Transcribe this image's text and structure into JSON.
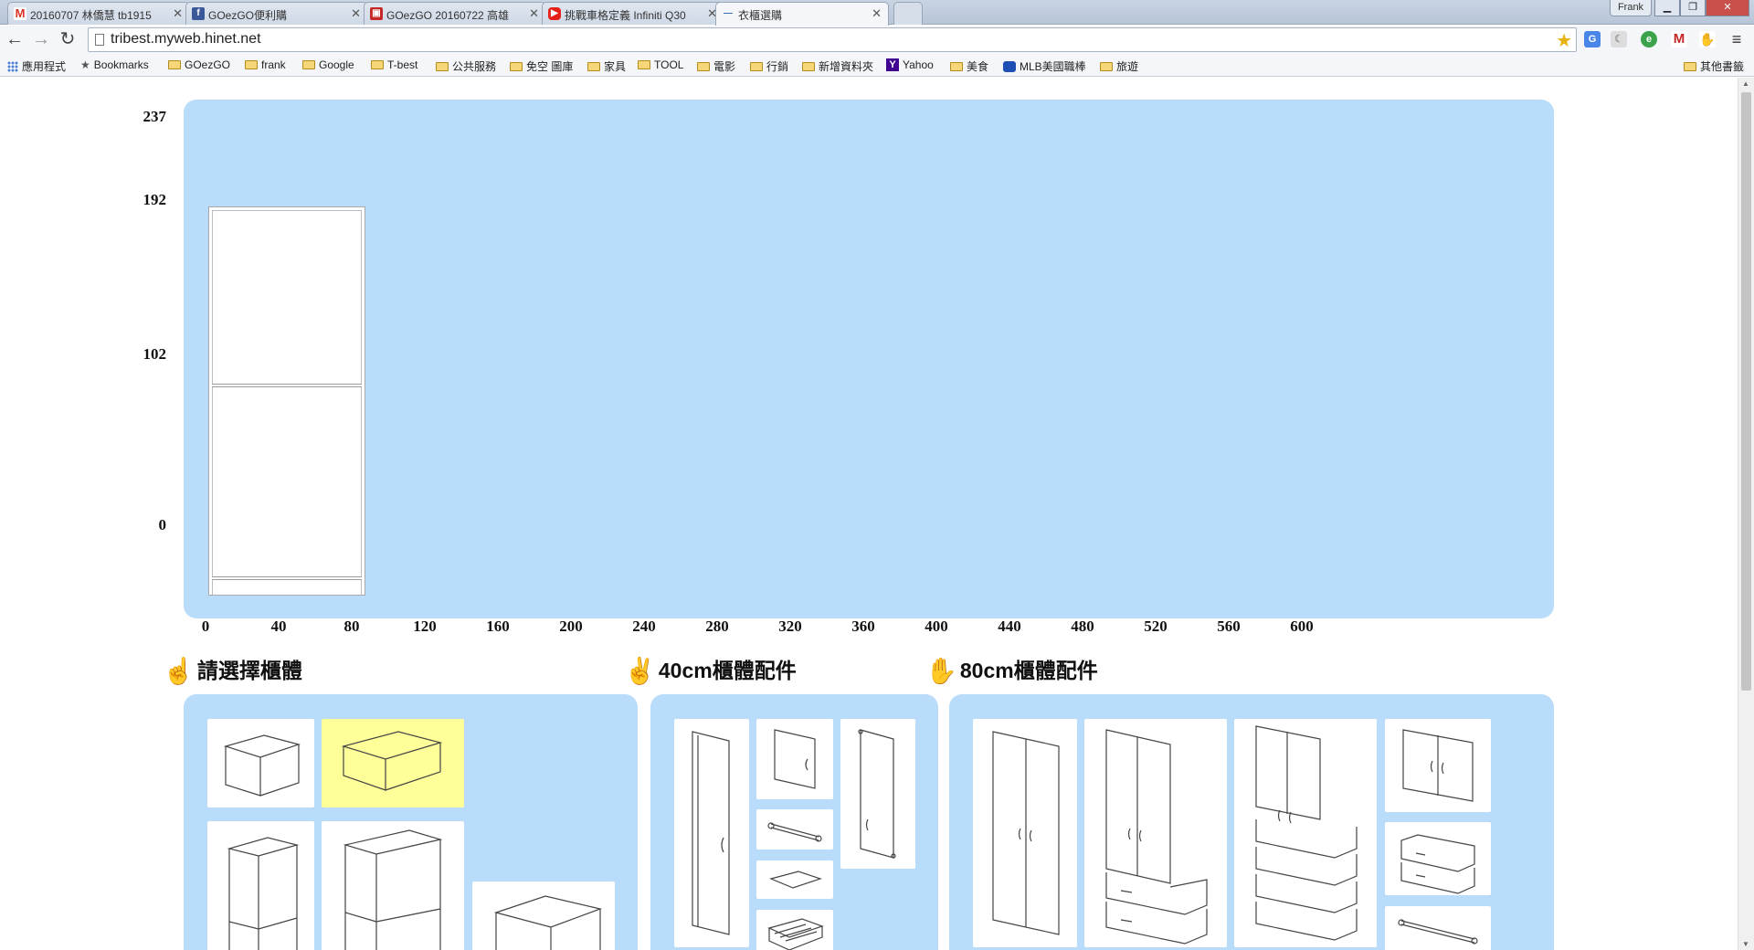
{
  "browser": {
    "tabs": [
      {
        "title": "20160707 林僑慧 tb1915",
        "favicon": "gmail-icon",
        "color": "#d93025"
      },
      {
        "title": "GOezGO便利購",
        "favicon": "facebook-icon",
        "color": "#3b5998"
      },
      {
        "title": "GOezGO 20160722 高雄",
        "favicon": "store-icon",
        "color": "#c62828"
      },
      {
        "title": "挑戰車格定義 Infiniti Q30",
        "favicon": "youtube-icon",
        "color": "#e62117"
      },
      {
        "title": "衣櫃選購",
        "favicon": "site-icon",
        "color": "#3a6fb0"
      }
    ],
    "profile_name": "Frank",
    "url": "tribest.myweb.hinet.net",
    "bookmarks": [
      {
        "label": "應用程式",
        "icon": "apps-icon"
      },
      {
        "label": "Bookmarks",
        "icon": "star-icon"
      },
      {
        "label": "GOezGO",
        "icon": "folder-icon"
      },
      {
        "label": "frank",
        "icon": "folder-icon"
      },
      {
        "label": "Google",
        "icon": "folder-icon"
      },
      {
        "label": "T-best",
        "icon": "folder-icon"
      },
      {
        "label": "公共服務",
        "icon": "folder-icon"
      },
      {
        "label": "免空 圖庫",
        "icon": "folder-icon"
      },
      {
        "label": "家具",
        "icon": "folder-icon"
      },
      {
        "label": "TOOL",
        "icon": "folder-icon"
      },
      {
        "label": "電影",
        "icon": "folder-icon"
      },
      {
        "label": "行銷",
        "icon": "folder-icon"
      },
      {
        "label": "新增資料夾",
        "icon": "folder-icon"
      },
      {
        "label": "Yahoo",
        "icon": "yahoo-icon"
      },
      {
        "label": "美食",
        "icon": "folder-icon"
      },
      {
        "label": "MLB美國職棒",
        "icon": "mlb-icon"
      },
      {
        "label": "旅遊",
        "icon": "folder-icon"
      }
    ],
    "other_bookmarks": "其他書籤"
  },
  "layout_area": {
    "y_ticks": [
      "237",
      "192",
      "102",
      "0"
    ],
    "x_ticks": [
      "0",
      "40",
      "80",
      "120",
      "160",
      "200",
      "240",
      "280",
      "320",
      "360",
      "400",
      "440",
      "480",
      "520",
      "560",
      "600"
    ],
    "y_values": [
      237,
      192,
      102,
      0
    ],
    "x_values": [
      0,
      40,
      80,
      120,
      160,
      200,
      240,
      280,
      320,
      360,
      400,
      440,
      480,
      520,
      560,
      600
    ],
    "placed_cabinet": {
      "x_start": 0,
      "width": 80,
      "height": 192,
      "shelves_at": [
        102,
        10
      ]
    }
  },
  "sections": {
    "cabinet_select": {
      "title": "請選擇櫃體"
    },
    "accessories_40": {
      "title": "40cm櫃體配件"
    },
    "accessories_80": {
      "title": "80cm櫃體配件"
    }
  },
  "colors": {
    "panel": "#badcfb",
    "selected": "#ffff99"
  }
}
